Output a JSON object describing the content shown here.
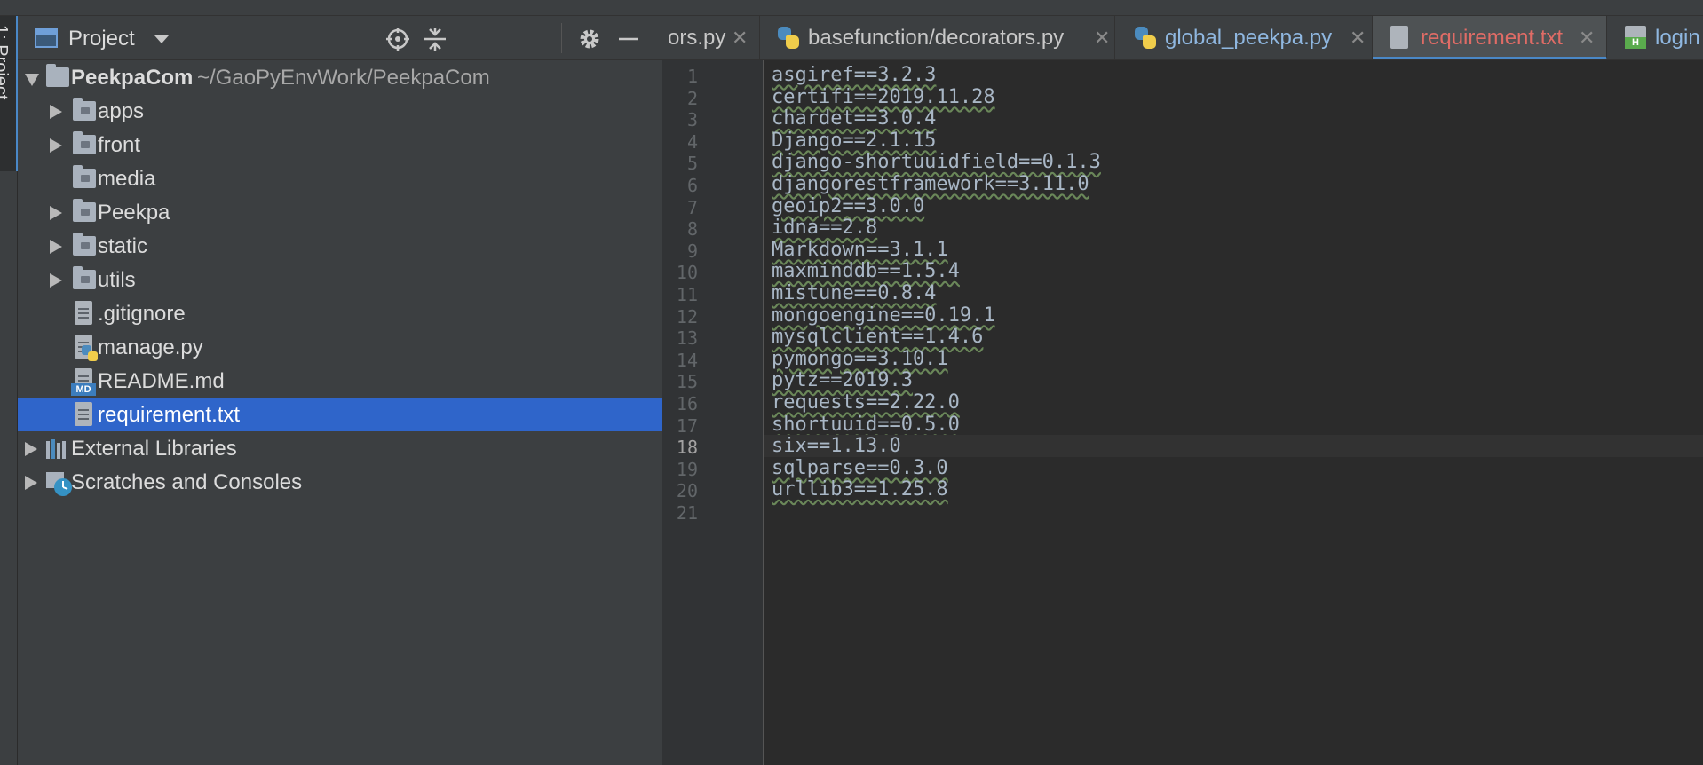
{
  "sidebar_tab": {
    "label": "1: Project"
  },
  "project_panel": {
    "title": "Project",
    "tree": {
      "root": {
        "name": "PeekpaCom",
        "path": "~/GaoPyEnvWork/PeekpaCom"
      },
      "items": [
        {
          "label": "apps",
          "kind": "folder",
          "expandable": true
        },
        {
          "label": "front",
          "kind": "folder",
          "expandable": true
        },
        {
          "label": "media",
          "kind": "folder",
          "expandable": false
        },
        {
          "label": "Peekpa",
          "kind": "folder",
          "expandable": true
        },
        {
          "label": "static",
          "kind": "folder",
          "expandable": true
        },
        {
          "label": "utils",
          "kind": "folder",
          "expandable": true
        },
        {
          "label": ".gitignore",
          "kind": "text-file",
          "expandable": false
        },
        {
          "label": "manage.py",
          "kind": "python-file",
          "expandable": false
        },
        {
          "label": "README.md",
          "kind": "markdown-file",
          "expandable": false
        },
        {
          "label": "requirement.txt",
          "kind": "text-file",
          "expandable": false,
          "selected": true
        }
      ],
      "external_libraries": "External Libraries",
      "scratches": "Scratches and Consoles"
    },
    "markdown_badge": "MD"
  },
  "editor": {
    "tabs": [
      {
        "label": "ors.py",
        "icon": "python-file-icon",
        "active": false
      },
      {
        "label": "basefunction/decorators.py",
        "icon": "python-file-icon",
        "active": false
      },
      {
        "label": "global_peekpa.py",
        "icon": "python-file-icon",
        "active": false
      },
      {
        "label": "requirement.txt",
        "icon": "text-file-icon",
        "active": true
      },
      {
        "label": "login",
        "icon": "html-file-icon",
        "active": false
      }
    ],
    "html_badge": "H",
    "current_line": 18,
    "lines": [
      "asgiref==3.2.3",
      "certifi==2019.11.28",
      "chardet==3.0.4",
      "Django==2.1.15",
      "django-shortuuidfield==0.1.3",
      "djangorestframework==3.11.0",
      "geoip2==3.0.0",
      "idna==2.8",
      "Markdown==3.1.1",
      "maxminddb==1.5.4",
      "mistune==0.8.4",
      "mongoengine==0.19.1",
      "mysqlclient==1.4.6",
      "pymongo==3.10.1",
      "pytz==2019.3",
      "requests==2.22.0",
      "shortuuid==0.5.0",
      "six==1.13.0",
      "sqlparse==0.3.0",
      "urllib3==1.25.8",
      ""
    ],
    "line_numbers": [
      "1",
      "2",
      "3",
      "4",
      "5",
      "6",
      "7",
      "8",
      "9",
      "10",
      "11",
      "12",
      "13",
      "14",
      "15",
      "16",
      "17",
      "18",
      "19",
      "20",
      "21"
    ]
  },
  "colors": {
    "selection": "#2f65ca",
    "active_tab_text": "#e06c66",
    "accent": "#4a88c7"
  }
}
